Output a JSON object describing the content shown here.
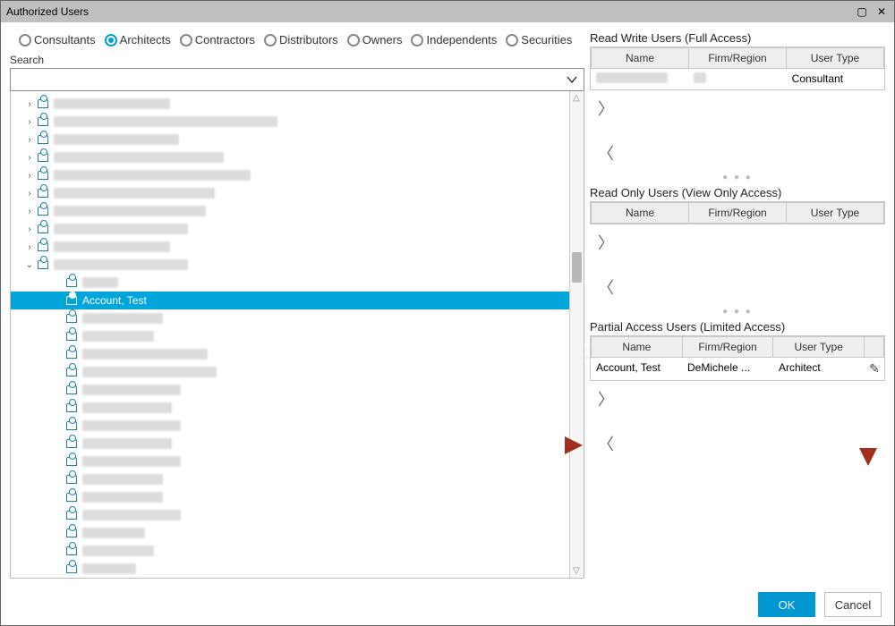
{
  "window": {
    "title": "Authorized Users"
  },
  "filters": {
    "options": [
      "Consultants",
      "Architects",
      "Contractors",
      "Distributors",
      "Owners",
      "Independents",
      "Securities"
    ],
    "selected": "Architects"
  },
  "search": {
    "label": "Search",
    "value": ""
  },
  "tree": {
    "selected_label": "Account, Test",
    "top_closed": [
      130,
      250,
      140,
      190,
      220,
      180,
      170,
      150,
      130
    ],
    "expanded_width": 150,
    "children_widths": [
      40,
      0,
      90,
      80,
      140,
      150,
      110,
      100,
      110,
      100,
      110,
      90,
      90,
      110,
      70,
      80,
      60
    ],
    "bottom_closed": [
      230,
      190
    ]
  },
  "panels": {
    "rw": {
      "title": "Read Write Users (Full Access)",
      "headers": [
        "Name",
        "Firm/Region",
        "User Type"
      ],
      "rows": [
        {
          "name_blur_width": 80,
          "firm_blur_width": 14,
          "type": "Consultant"
        }
      ]
    },
    "ro": {
      "title": "Read Only Users (View Only Access)",
      "headers": [
        "Name",
        "Firm/Region",
        "User Type"
      ],
      "rows": []
    },
    "partial": {
      "title": "Partial Access Users (Limited Access)",
      "headers": [
        "Name",
        "Firm/Region",
        "User Type",
        ""
      ],
      "rows": [
        {
          "name": "Account, Test",
          "firm": "DeMichele ...",
          "type": "Architect"
        }
      ]
    }
  },
  "buttons": {
    "ok": "OK",
    "cancel": "Cancel"
  }
}
